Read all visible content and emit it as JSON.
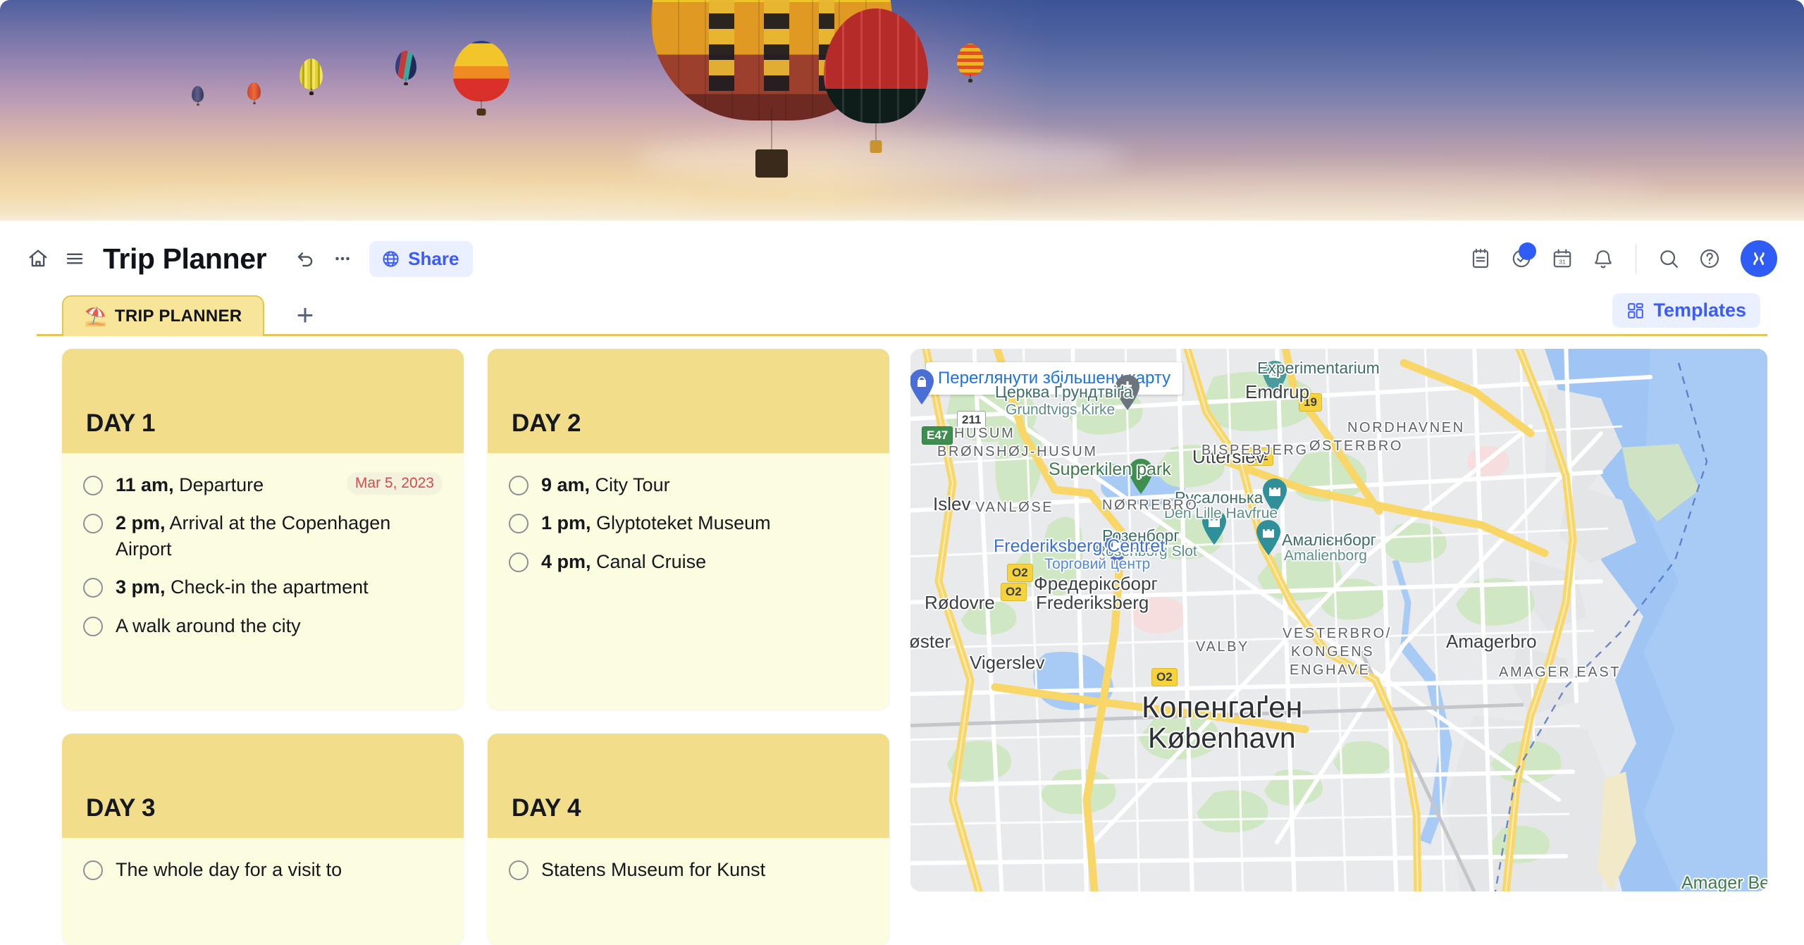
{
  "banner": {
    "alt": "hot-air-balloons-at-sunset"
  },
  "topbar": {
    "home_icon": "home-icon",
    "menu_icon": "hamburger-menu-icon",
    "title": "Trip Planner",
    "undo_icon": "undo-icon",
    "more_icon": "more-options-icon",
    "share_label": "Share",
    "share_icon": "globe-icon",
    "right_icons": [
      {
        "name": "notepad-icon"
      },
      {
        "name": "tasks-icon",
        "has_badge": true
      },
      {
        "name": "calendar-icon",
        "day": "31"
      },
      {
        "name": "notifications-bell-icon"
      },
      {
        "name": "search-icon"
      },
      {
        "name": "help-icon"
      }
    ],
    "avatar": "user-avatar"
  },
  "tabs": {
    "items": [
      {
        "emoji": "⛱️",
        "label": "TRIP PLANNER",
        "active": true
      }
    ],
    "add_label": "+",
    "templates_label": "Templates",
    "templates_icon": "templates-grid-icon"
  },
  "cards": [
    {
      "title": "DAY 1",
      "items": [
        {
          "time": "11 am,",
          "text": " Departure",
          "date": "Mar 5, 2023"
        },
        {
          "time": "2 pm,",
          "text": " Arrival at the Copenhagen Airport"
        },
        {
          "time": "3 pm,",
          "text": " Check-in the apartment"
        },
        {
          "time": "",
          "text": "A walk around the city"
        }
      ]
    },
    {
      "title": "DAY 2",
      "items": [
        {
          "time": "9 am,",
          "text": " City Tour"
        },
        {
          "time": "1 pm,",
          "text": " Glyptoteket Museum"
        },
        {
          "time": "4 pm,",
          "text": "  Canal Cruise"
        }
      ]
    },
    {
      "title": "DAY 3",
      "items": [
        {
          "time": "",
          "text": "The whole day for a visit to"
        }
      ]
    },
    {
      "title": "DAY 4",
      "items": [
        {
          "time": "",
          "text": "Statens Museum for Kunst"
        }
      ]
    }
  ],
  "map": {
    "zoom_link": "Переглянути збільшену карту",
    "city_primary": "Копенгаґен",
    "city_secondary": "København",
    "labels": {
      "emdrup": "Emdrup",
      "utterslev": "Utterslev",
      "islev": "Islev",
      "rodovre": "Rødovre",
      "vigerslev": "Vigerslev",
      "oster": "øster",
      "amagerbro": "Amagerbro",
      "grundtvigs_ua": "Церква Ґрундтвіґа",
      "grundtvigs_dk": "Grundtvigs Kirke",
      "mermaid_ua": "Русалонька",
      "mermaid_dk": "Den Lille Havfrue",
      "rosenborg_ua": "Розенборг",
      "rosenborg_dk": "Rosenborg Slot",
      "amalienborg_ua": "Амалієнборг",
      "amalienborg_dk": "Amalienborg",
      "frederiksberg_ua": "Фредеріксборг",
      "frederiksberg_dk": "Frederiksberg",
      "centret": "Frederiksberg Centret",
      "centret_ua": "Торговий центр",
      "superkilen": "Superkilen park",
      "experimentarium": "Experimentarium",
      "amager_beach": "Amager Beach",
      "husum": "HUSUM",
      "bronshoj_husum": "BRØNSHØJ-HUSUM",
      "bispebjerg": "BISPEBJERG",
      "vanlose": "VANLØSE",
      "norrebro": "NØRREBRO",
      "osterbro": "ØSTERBRO",
      "nordhavnen": "NORDHAVNEN",
      "valby": "VALBY",
      "vesterbro": "VESTERBRO/",
      "kongens": "KONGENS",
      "enghave": "ENGHAVE",
      "amager_east": "AMAGER EAST"
    },
    "road_shields": [
      {
        "id": "E47",
        "kind": "g"
      },
      {
        "id": "211",
        "kind": "w"
      },
      {
        "id": "19",
        "kind": "y"
      },
      {
        "id": "O2",
        "kind": "y"
      }
    ]
  },
  "colors": {
    "accent_blue": "#2f5cf5",
    "link_blue": "#1a73e8",
    "tab_yellow": "#f7e59a",
    "tab_border": "#e3c65a",
    "card_head": "#f2de8a",
    "card_body": "#fcfce0",
    "date_red": "#d64b4b"
  }
}
